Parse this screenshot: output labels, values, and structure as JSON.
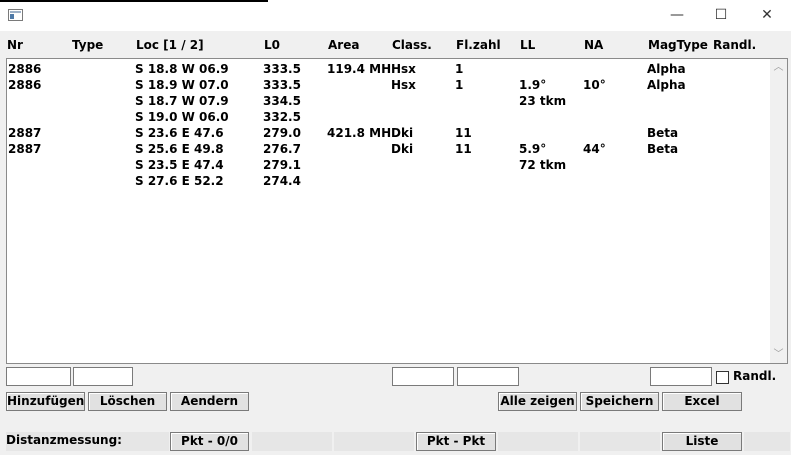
{
  "window": {
    "minimize": "—",
    "maximize": "☐",
    "close": "✕"
  },
  "columns": [
    "Nr",
    "Type",
    "Loc [1 / 2]",
    "L0",
    "Area",
    "Class.",
    "Fl.zahl",
    "LL",
    "NA",
    "MagType",
    "Randl."
  ],
  "rows": [
    {
      "nr": "2886",
      "type": "",
      "loc": "S 18.8 W 06.9",
      "l0": "333.5",
      "area": "119.4 MH",
      "cls": "Hsx",
      "fl": "1",
      "ll": "",
      "na": "",
      "mag": "Alpha",
      "randl": ""
    },
    {
      "nr": "2886",
      "type": "",
      "loc": "S 18.9 W 07.0",
      "l0": "333.5",
      "area": "",
      "cls": "Hsx",
      "fl": "1",
      "ll": "1.9°",
      "na": "10°",
      "mag": "Alpha",
      "randl": ""
    },
    {
      "nr": "",
      "type": "",
      "loc": "S 18.7 W 07.9",
      "l0": "334.5",
      "area": "",
      "cls": "",
      "fl": "",
      "ll": "23 tkm",
      "na": "",
      "mag": "",
      "randl": ""
    },
    {
      "nr": "",
      "type": "",
      "loc": "S 19.0 W 06.0",
      "l0": "332.5",
      "area": "",
      "cls": "",
      "fl": "",
      "ll": "",
      "na": "",
      "mag": "",
      "randl": ""
    },
    {
      "nr": "2887",
      "type": "",
      "loc": "S 23.6 E 47.6",
      "l0": "279.0",
      "area": "421.8 MH",
      "cls": "Dki",
      "fl": "11",
      "ll": "",
      "na": "",
      "mag": "Beta",
      "randl": ""
    },
    {
      "nr": "2887",
      "type": "",
      "loc": "S 25.6 E 49.8",
      "l0": "276.7",
      "area": "",
      "cls": "Dki",
      "fl": "11",
      "ll": "5.9°",
      "na": "44°",
      "mag": "Beta",
      "randl": ""
    },
    {
      "nr": "",
      "type": "",
      "loc": "S 23.5 E 47.4",
      "l0": "279.1",
      "area": "",
      "cls": "",
      "fl": "",
      "ll": "72 tkm",
      "na": "",
      "mag": "",
      "randl": ""
    },
    {
      "nr": "",
      "type": "",
      "loc": "S 27.6 E 52.2",
      "l0": "274.4",
      "area": "",
      "cls": "",
      "fl": "",
      "ll": "",
      "na": "",
      "mag": "",
      "randl": ""
    }
  ],
  "inputs": {
    "f1": "",
    "f2": "",
    "f3": "",
    "f4": "",
    "f5": ""
  },
  "randl_checkbox": {
    "label": "Randl.",
    "checked": false
  },
  "buttons": {
    "add": "Hinzufügen",
    "delete": "Löschen",
    "edit": "Aendern",
    "show_all": "Alle zeigen",
    "save": "Speichern",
    "excel": "Excel",
    "pkt0": "Pkt - 0/0",
    "pktpkt": "Pkt - Pkt",
    "list": "Liste"
  },
  "distance_label": "Distanzmessung:"
}
